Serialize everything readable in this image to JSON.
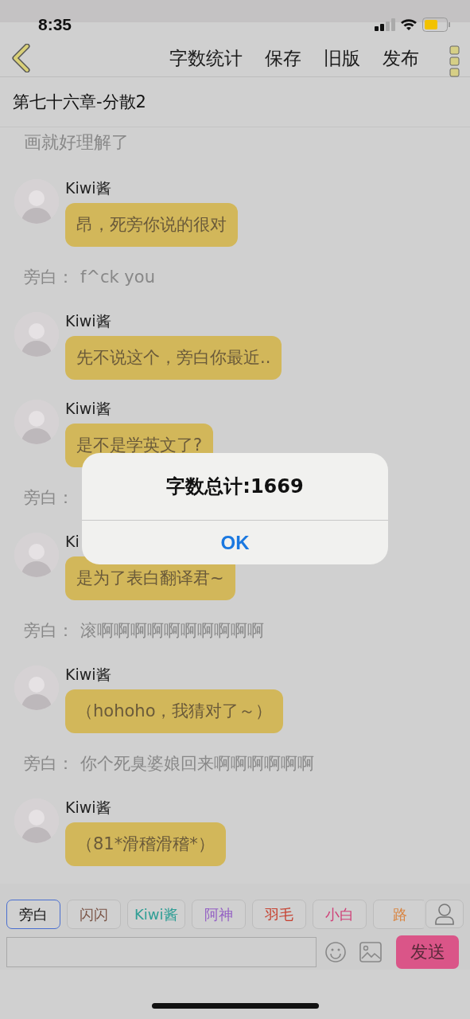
{
  "status_bar": {
    "time": "8:35"
  },
  "nav": {
    "actions": [
      "字数统计",
      "保存",
      "旧版",
      "发布"
    ]
  },
  "chapter_title": "第七十六章-分散2",
  "messages": [
    {
      "kind": "fragment",
      "text": "画就好理解了"
    },
    {
      "kind": "chat",
      "speaker": "Kiwi酱",
      "text": "昂，死旁你说的很对"
    },
    {
      "kind": "narration",
      "speaker": "旁白：",
      "text": "f^ck you"
    },
    {
      "kind": "chat",
      "speaker": "Kiwi酱",
      "text": "先不说这个，旁白你最近.."
    },
    {
      "kind": "chat",
      "speaker": "Kiwi酱",
      "text": "是不是学英文了?"
    },
    {
      "kind": "narration",
      "speaker": "旁白："
    },
    {
      "kind": "chat",
      "speaker": "Ki",
      "text": "是为了表白翻译君~"
    },
    {
      "kind": "narration",
      "speaker": "旁白：",
      "text": "滚啊啊啊啊啊啊啊啊啊啊"
    },
    {
      "kind": "chat",
      "speaker": "Kiwi酱",
      "text": "（hohoho，我猜对了～）"
    },
    {
      "kind": "narration",
      "speaker": "旁白：",
      "text": "你个死臭婆娘回来啊啊啊啊啊啊"
    },
    {
      "kind": "chat",
      "speaker": "Kiwi酱",
      "text": "（81*滑稽滑稽*）"
    }
  ],
  "roles": [
    {
      "label": "旁白",
      "selected": true,
      "color": "#111111"
    },
    {
      "label": "闪闪",
      "selected": false,
      "color": "#7a5446"
    },
    {
      "label": "Kiwi酱",
      "selected": false,
      "color": "#2f9e95"
    },
    {
      "label": "阿神",
      "selected": false,
      "color": "#9460c4"
    },
    {
      "label": "羽毛",
      "selected": false,
      "color": "#c6402f"
    },
    {
      "label": "小白",
      "selected": false,
      "color": "#cf3f77"
    },
    {
      "label": "路",
      "selected": false,
      "color": "#d9843f"
    }
  ],
  "send_button": "发送",
  "alert": {
    "title": "字数总计:1669",
    "button": "OK"
  }
}
